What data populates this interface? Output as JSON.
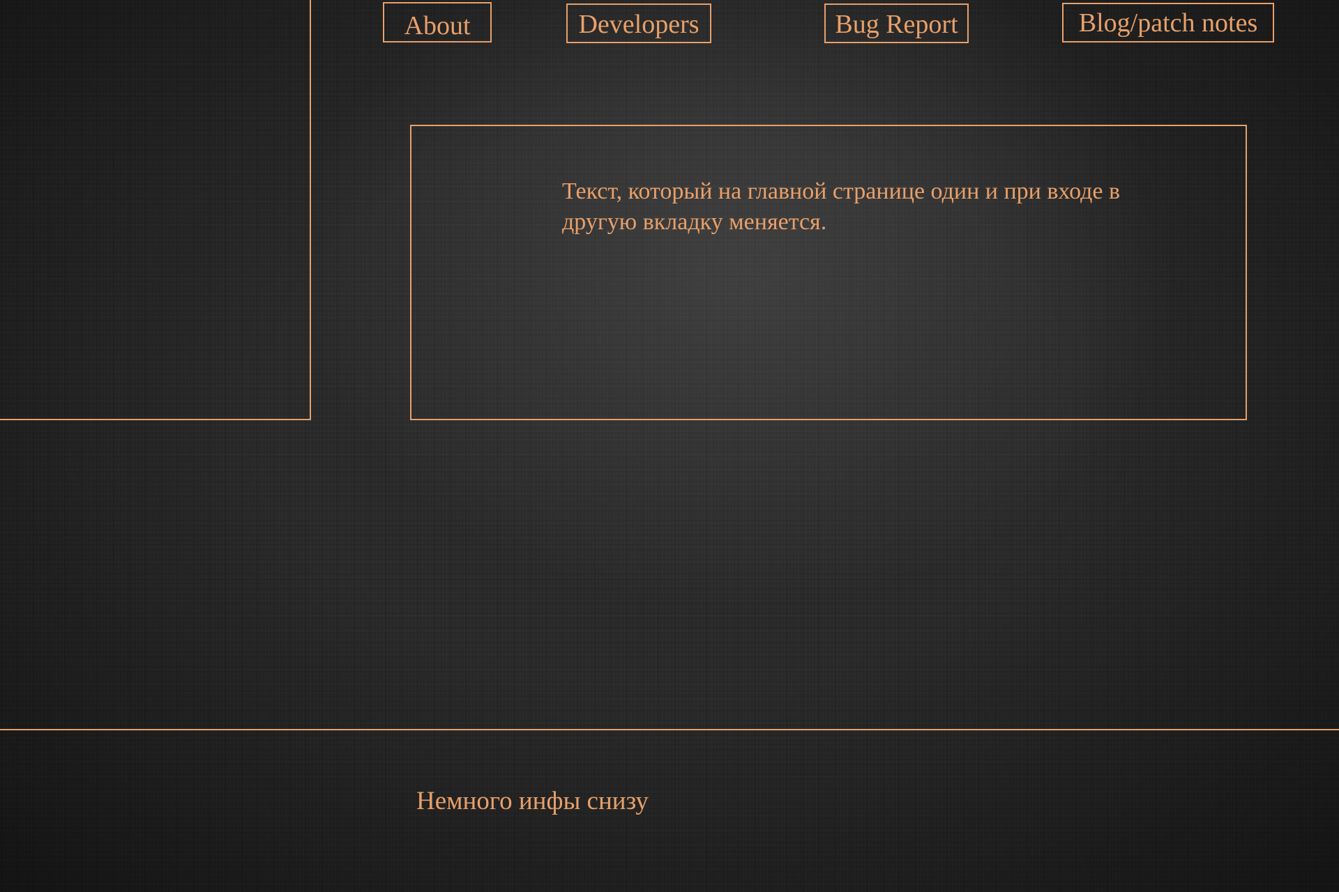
{
  "nav": {
    "about_label": "About",
    "developers_label": "Developers",
    "bug_report_label": "Bug Report",
    "blog_label": "Blog/patch notes"
  },
  "main": {
    "content_text": "Текст, который на главной странице один и при входе в другую вкладку меняется."
  },
  "footer": {
    "text": "Немного инфы снизу"
  },
  "colors": {
    "accent": "#e8a06a",
    "background": "#2a2a2a"
  }
}
